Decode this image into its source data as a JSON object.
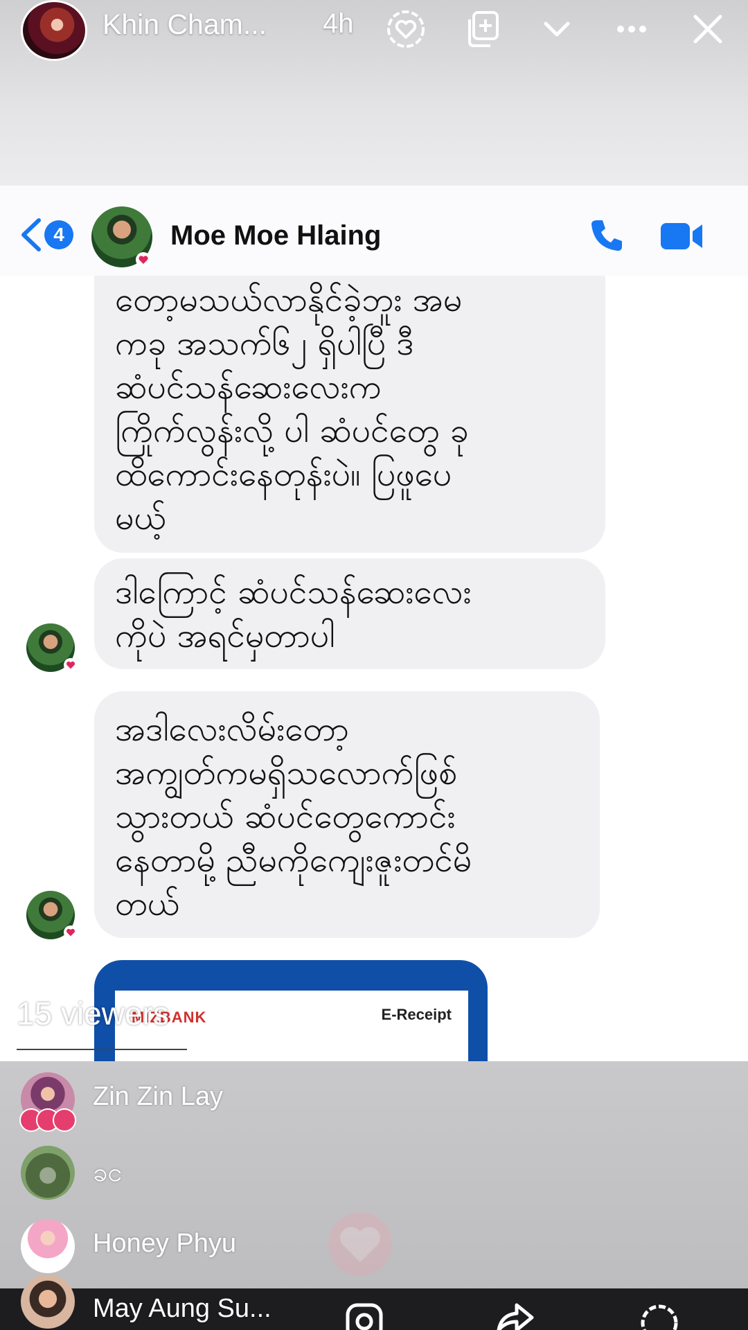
{
  "story": {
    "author_name": "Khin Cham...",
    "time_ago": "4h"
  },
  "messenger": {
    "back_count": "4",
    "contact_name": "Moe Moe Hlaing"
  },
  "messages": [
    {
      "text": "တော့မသယ်လာနိုင်ခဲ့ဘူး အမ\nကခု အသက်၆၂ ရှိပါပြီ ဒီ\nဆံပင်သန်ဆေးလေးက\nကြိုက်လွန်းလို့ ပါ ဆံပင်တွေ ခု\nထိကောင်းနေတုန်းပဲ။ ပြဖူပေ\nမယ့်"
    },
    {
      "text": "ဒါကြောင့် ဆံပင်သန်ဆေးလေး\nကိုပဲ အရင်မှတာပါ"
    },
    {
      "text": "အဒါလေးလိမ်းတော့\nအကျွတ်ကမရှိသလောက်ဖြစ်\nသွားတယ် ဆံပင်တွေကောင်း\nနေတာမို့ ညီမကိုကျေးဇူးတင်မိ\nတယ်"
    }
  ],
  "receipt": {
    "bank": "MIZBANK",
    "title": "E-Receipt"
  },
  "viewers": {
    "count_label": "15 viewers",
    "list": [
      {
        "name": "Zin Zin Lay"
      },
      {
        "name": "ခင"
      },
      {
        "name": "Honey Phyu"
      },
      {
        "name": "May Aung Su..."
      }
    ]
  },
  "colors": {
    "accent": "#1877f2",
    "bubble": "#f0f0f3",
    "receipt_blue": "#0f4fa8",
    "reaction": "#e53e6e"
  },
  "icons": {
    "story_actions": [
      "heart-icon",
      "add-icon",
      "chevron-down-icon",
      "more-icon",
      "close-icon"
    ],
    "messenger_actions": [
      "phone-icon",
      "video-icon"
    ],
    "bottom_actions": [
      "instagram-icon",
      "share-icon",
      "heart-icon"
    ]
  }
}
